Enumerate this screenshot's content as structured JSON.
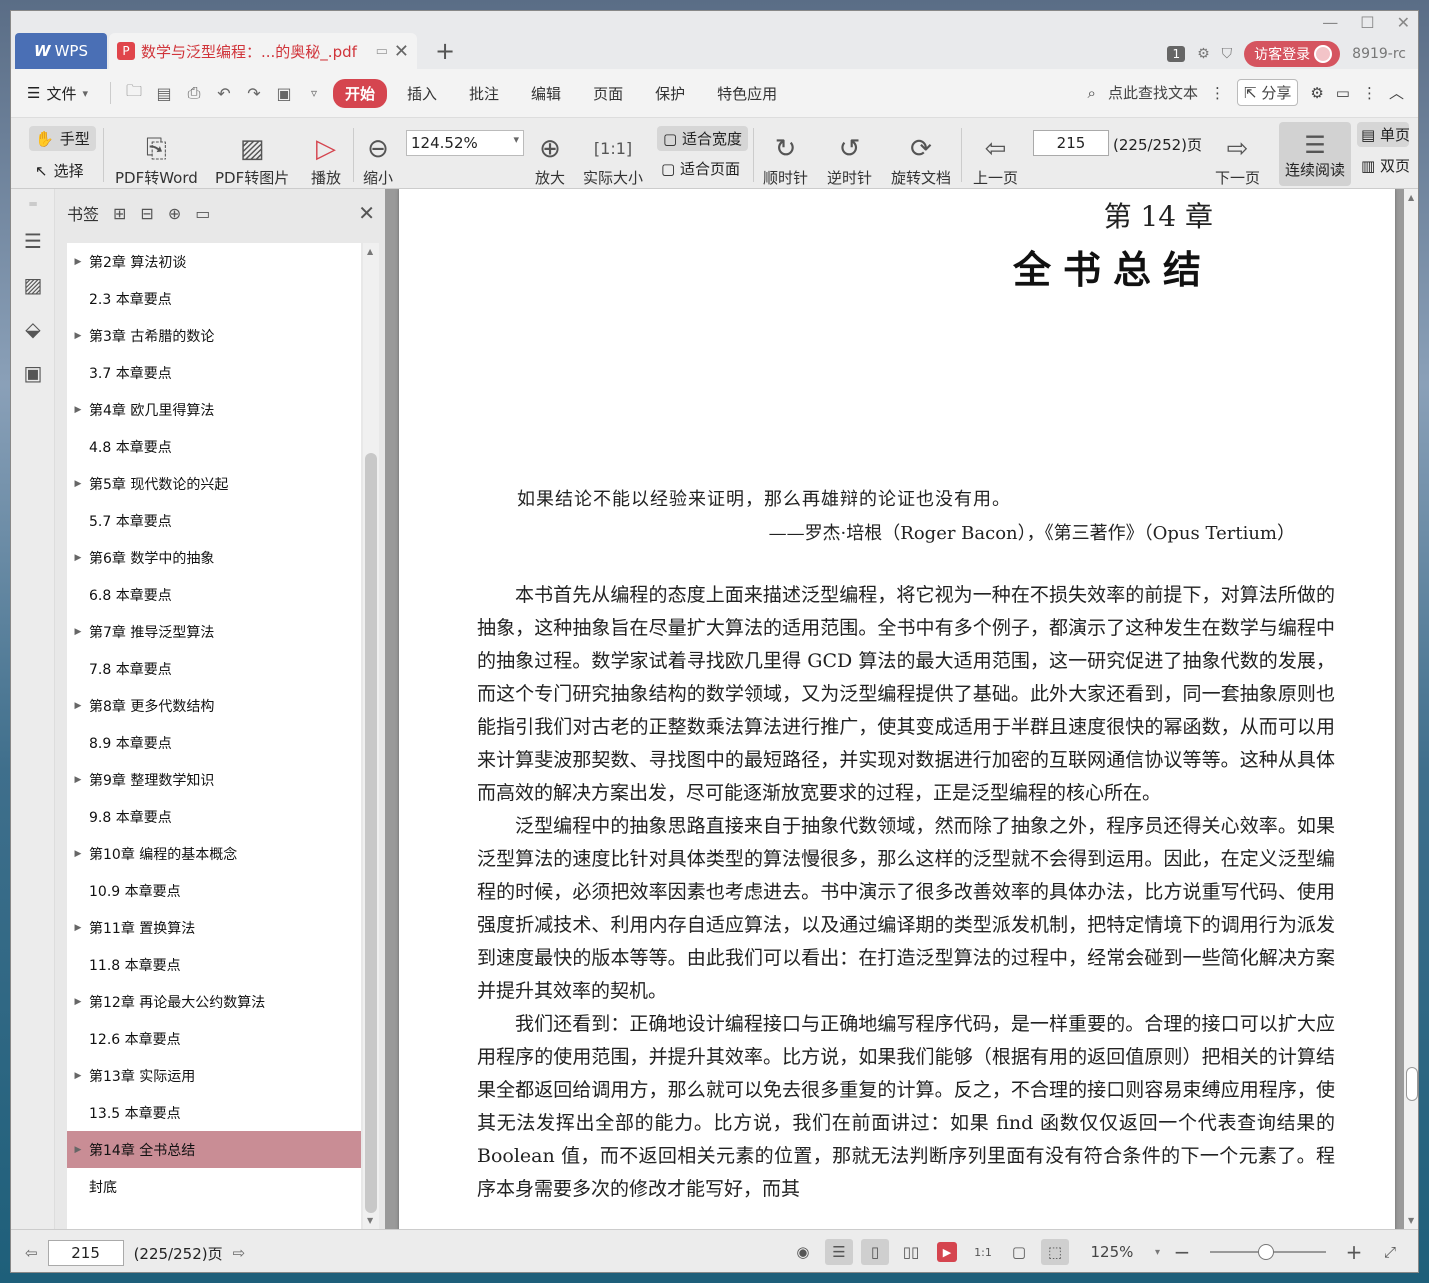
{
  "titlebar": {
    "app_tab": "WPS",
    "doc_tab": "数学与泛型编程：...的奥秘_.pdf",
    "badge": "1",
    "login": "访客登录",
    "user": "8919-rc"
  },
  "menubar": {
    "file": "文件",
    "tabs": [
      "开始",
      "插入",
      "批注",
      "编辑",
      "页面",
      "保护",
      "特色应用"
    ],
    "search": "点此查找文本",
    "share": "分享"
  },
  "toolbar": {
    "hand": "手型",
    "select": "选择",
    "pdf2word": "PDF转Word",
    "pdf2img": "PDF转图片",
    "play": "播放",
    "zoom_out": "缩小",
    "zoom_value": "124.52%",
    "zoom_in": "放大",
    "actual_size": "实际大小",
    "fit_width": "适合宽度",
    "fit_page": "适合页面",
    "clockwise": "顺时针",
    "counterclockwise": "逆时针",
    "rotate_doc": "旋转文档",
    "prev_page": "上一页",
    "page_input": "215",
    "page_total": "(225/252)页",
    "next_page": "下一页",
    "continuous": "连续阅读",
    "single": "单页",
    "double": "双页"
  },
  "bookmarks": {
    "title": "书签",
    "items": [
      {
        "label": "第2章  算法初谈",
        "child": false,
        "selected": false
      },
      {
        "label": "2.3  本章要点",
        "child": true,
        "selected": false
      },
      {
        "label": "第3章  古希腊的数论",
        "child": false,
        "selected": false
      },
      {
        "label": "3.7  本章要点",
        "child": true,
        "selected": false
      },
      {
        "label": "第4章  欧几里得算法",
        "child": false,
        "selected": false
      },
      {
        "label": "4.8  本章要点",
        "child": true,
        "selected": false
      },
      {
        "label": "第5章  现代数论的兴起",
        "child": false,
        "selected": false
      },
      {
        "label": "5.7  本章要点",
        "child": true,
        "selected": false
      },
      {
        "label": "第6章  数学中的抽象",
        "child": false,
        "selected": false
      },
      {
        "label": "6.8  本章要点",
        "child": true,
        "selected": false
      },
      {
        "label": "第7章  推导泛型算法",
        "child": false,
        "selected": false
      },
      {
        "label": "7.8  本章要点",
        "child": true,
        "selected": false
      },
      {
        "label": "第8章  更多代数结构",
        "child": false,
        "selected": false
      },
      {
        "label": "8.9  本章要点",
        "child": true,
        "selected": false
      },
      {
        "label": "第9章  整理数学知识",
        "child": false,
        "selected": false
      },
      {
        "label": "9.8  本章要点",
        "child": true,
        "selected": false
      },
      {
        "label": "第10章  编程的基本概念",
        "child": false,
        "selected": false
      },
      {
        "label": "10.9  本章要点",
        "child": true,
        "selected": false
      },
      {
        "label": "第11章  置换算法",
        "child": false,
        "selected": false
      },
      {
        "label": "11.8  本章要点",
        "child": true,
        "selected": false
      },
      {
        "label": "第12章  再论最大公约数算法",
        "child": false,
        "selected": false
      },
      {
        "label": "12.6  本章要点",
        "child": true,
        "selected": false
      },
      {
        "label": "第13章  实际运用",
        "child": false,
        "selected": false
      },
      {
        "label": "13.5  本章要点",
        "child": true,
        "selected": false
      },
      {
        "label": "第14章  全书总结",
        "child": false,
        "selected": true
      },
      {
        "label": "封底",
        "child": true,
        "selected": false
      }
    ]
  },
  "document": {
    "chapter_no": "第 14 章",
    "chapter_title": "全书总结",
    "quote": "如果结论不能以经验来证明，那么再雄辩的论证也没有用。",
    "quote_source": "——罗杰·培根（Roger Bacon），《第三著作》（Opus Tertium）",
    "paragraphs": [
      "本书首先从编程的态度上面来描述泛型编程，将它视为一种在不损失效率的前提下，对算法所做的抽象，这种抽象旨在尽量扩大算法的适用范围。全书中有多个例子，都演示了这种发生在数学与编程中的抽象过程。数学家试着寻找欧几里得 GCD 算法的最大适用范围，这一研究促进了抽象代数的发展，而这个专门研究抽象结构的数学领域，又为泛型编程提供了基础。此外大家还看到，同一套抽象原则也能指引我们对古老的正整数乘法算法进行推广，使其变成适用于半群且速度很快的幂函数，从而可以用来计算斐波那契数、寻找图中的最短路径，并实现对数据进行加密的互联网通信协议等等。这种从具体而高效的解决方案出发，尽可能逐渐放宽要求的过程，正是泛型编程的核心所在。",
      "泛型编程中的抽象思路直接来自于抽象代数领域，然而除了抽象之外，程序员还得关心效率。如果泛型算法的速度比针对具体类型的算法慢很多，那么这样的泛型就不会得到运用。因此，在定义泛型编程的时候，必须把效率因素也考虑进去。书中演示了很多改善效率的具体办法，比方说重写代码、使用强度折减技术、利用内存自适应算法，以及通过编译期的类型派发机制，把特定情境下的调用行为派发到速度最快的版本等等。由此我们可以看出：在打造泛型算法的过程中，经常会碰到一些简化解决方案并提升其效率的契机。",
      "我们还看到：正确地设计编程接口与正确地编写程序代码，是一样重要的。合理的接口可以扩大应用程序的使用范围，并提升其效率。比方说，如果我们能够（根据有用的返回值原则）把相关的计算结果全都返回给调用方，那么就可以免去很多重复的计算。反之，不合理的接口则容易束缚应用程序，使其无法发挥出全部的能力。比方说，我们在前面讲过：如果 find 函数仅仅返回一个代表查询结果的 Boolean 值，而不返回相关元素的位置，那就无法判断序列里面有没有符合条件的下一个元素了。程序本身需要多次的修改才能写好，而其"
    ]
  },
  "statusbar": {
    "page_input": "215",
    "page_total": "(225/252)页",
    "zoom": "125%"
  }
}
